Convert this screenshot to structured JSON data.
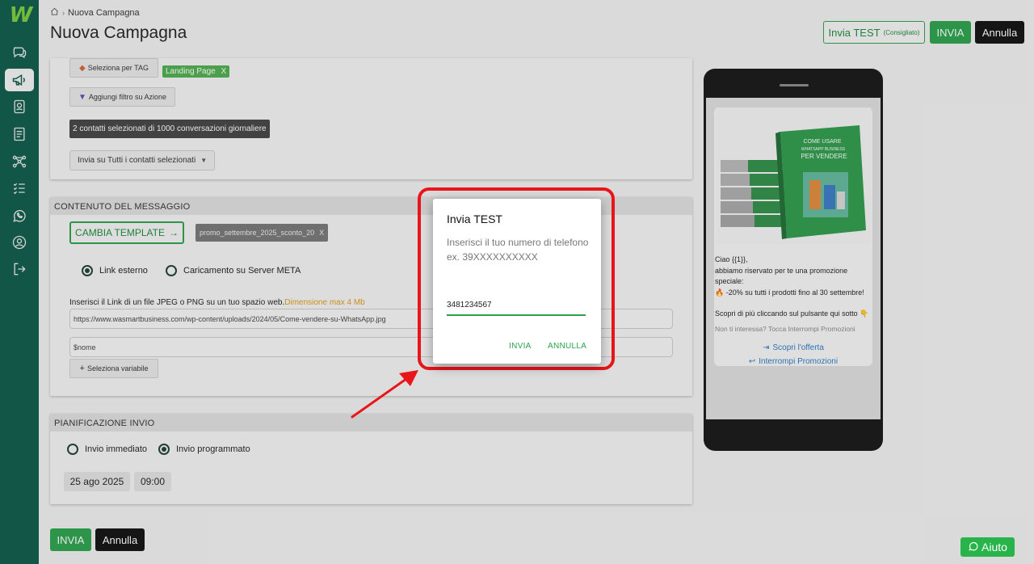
{
  "header": {
    "breadcrumb": "Nuova Campagna",
    "title": "Nuova Campagna",
    "test_button": "Invia TEST",
    "test_hint": "(Consigliato)",
    "send_button": "INVIA",
    "cancel_button": "Annulla"
  },
  "audience": {
    "tag_button": "Seleziona per TAG",
    "tag_chip": "Landing Page",
    "tag_remove": "X",
    "filter_button": "Aggiungi filtro su Azione",
    "selection_info": "2 contatti selezionati di 1000 conversazioni giornaliere",
    "send_mode": "Invia su Tutti i contatti selezionati"
  },
  "content": {
    "header": "CONTENUTO DEL MESSAGGIO",
    "change_template": "CAMBIA TEMPLATE",
    "template_name": "promo_settembre_2025_sconto_20",
    "template_remove": "X",
    "radio_external": "Link esterno",
    "radio_meta": "Caricamento su Server META",
    "help_text": "Inserisci il Link di un file JPEG o PNG su un tuo spazio web.",
    "help_max": "Dimensione max 4 Mb",
    "image_url": "https://www.wasmartbusiness.com/wp-content/uploads/2024/05/Come-vendere-su-WhatsApp.jpg",
    "variable_field": "$nome",
    "select_variable": "Seleziona variabile"
  },
  "schedule": {
    "header": "PIANIFICAZIONE INVIO",
    "immediate": "Invio immediato",
    "scheduled": "Invio programmato",
    "date": "25 ago 2025",
    "time": "09:00"
  },
  "footer": {
    "send_button": "INVIA",
    "cancel_button": "Annulla"
  },
  "preview": {
    "book_line1": "COME USARE",
    "book_line2": "WHATSAPP BUSINESS",
    "book_line3": "PER VENDERE",
    "greeting": "Ciao {{1}},",
    "line1": "abbiamo riservato per te una promozione speciale:",
    "line2": "🔥 -20% su tutti i prodotti fino al 30 settembre!",
    "line3": "Scopri di più cliccando sul pulsante qui sotto 👇",
    "footer": "Non ti interessa? Tocca Interrompi Promozioni",
    "button1": "Scopri l'offerta",
    "button2": "Interrompi Promozioni"
  },
  "dialog": {
    "title": "Invia TEST",
    "text": "Inserisci il tuo numero di telefono ex. 39XXXXXXXXXX",
    "phone_value": "3481234567",
    "send": "INVIA",
    "cancel": "ANNULLA"
  },
  "help_widget": {
    "label": "Aiuto"
  },
  "colors": {
    "sidebar": "#0d5b4a",
    "accent_green": "#2ba24c",
    "highlight_red": "#e8161a",
    "link_blue": "#2d7bc4"
  },
  "icons": [
    "logo",
    "chat-icon",
    "megaphone-icon",
    "contacts-icon",
    "template-icon",
    "flow-icon",
    "checklist-icon",
    "whatsapp-icon",
    "user-icon",
    "logout-icon",
    "home-icon"
  ]
}
